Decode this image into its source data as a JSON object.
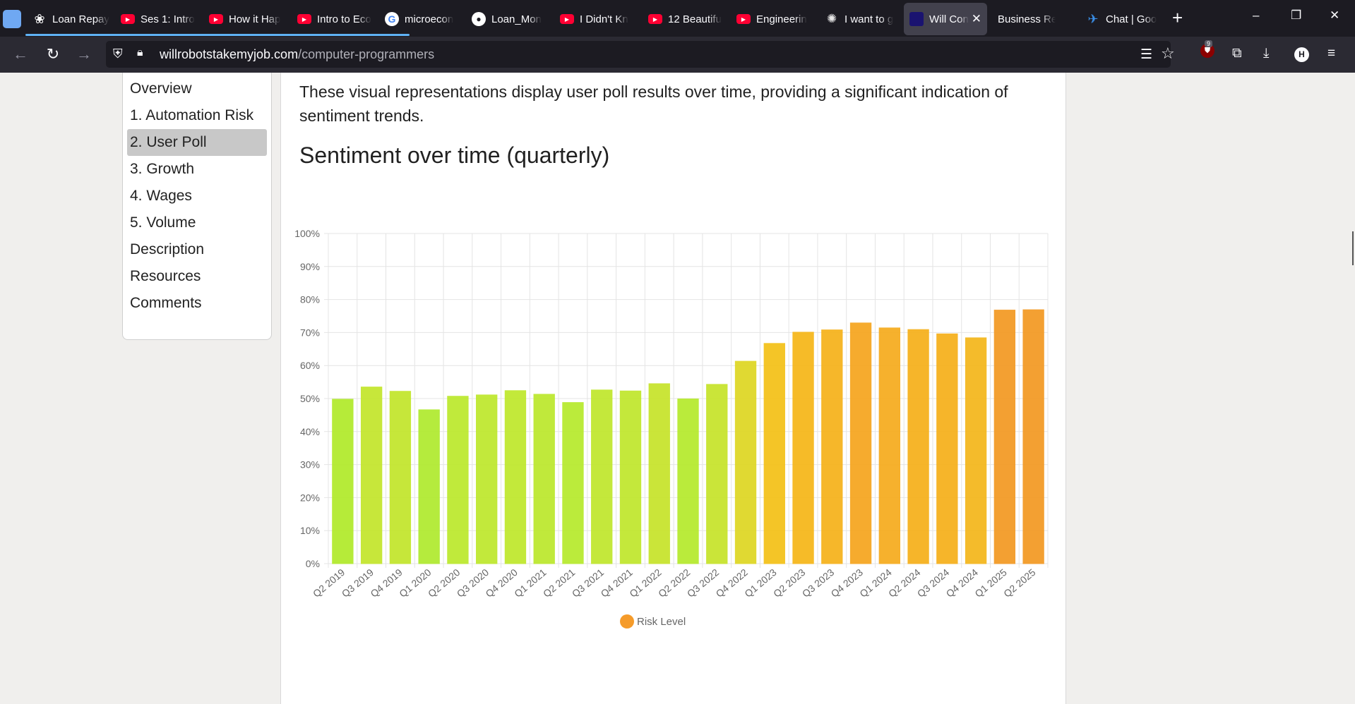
{
  "browser": {
    "tabs": [
      {
        "title": "Loan Repay",
        "icon": "chatgpt-icon"
      },
      {
        "title": "Ses 1: Intro",
        "icon": "youtube-icon"
      },
      {
        "title": "How it Hap",
        "icon": "youtube-icon"
      },
      {
        "title": "Intro to Eco",
        "icon": "youtube-icon"
      },
      {
        "title": "microecon",
        "icon": "google-icon"
      },
      {
        "title": "Loan_Mon",
        "icon": "github-icon"
      },
      {
        "title": "I Didn't Kn",
        "icon": "youtube-icon"
      },
      {
        "title": "12 Beautifu",
        "icon": "youtube-icon"
      },
      {
        "title": "Engineerin",
        "icon": "youtube-icon"
      },
      {
        "title": "I want to g",
        "icon": "claude-icon"
      },
      {
        "title": "Will Con",
        "icon": "site-icon",
        "active": true
      },
      {
        "title": "Business Repor",
        "icon": "none"
      },
      {
        "title": "Chat | Goo",
        "icon": "chatbot-icon"
      }
    ],
    "url_domain": "willrobotstakemyjob.com",
    "url_path": "/computer-programmers",
    "extension_badge_count": "9",
    "profile_initial": "H"
  },
  "toc": {
    "items": [
      "Overview",
      "1. Automation Risk",
      "2. User Poll",
      "3. Growth",
      "4. Wages",
      "5. Volume",
      "Description",
      "Resources",
      "Comments"
    ],
    "active_index": 2
  },
  "content": {
    "intro": "These visual representations display user poll results over time, providing a significant indication of sentiment trends.",
    "heading": "Sentiment over time (quarterly)"
  },
  "chart_data": {
    "type": "bar",
    "categories": [
      "Q2 2019",
      "Q3 2019",
      "Q4 2019",
      "Q1 2020",
      "Q2 2020",
      "Q3 2020",
      "Q4 2020",
      "Q1 2021",
      "Q2 2021",
      "Q3 2021",
      "Q4 2021",
      "Q1 2022",
      "Q2 2022",
      "Q3 2022",
      "Q4 2022",
      "Q1 2023",
      "Q2 2023",
      "Q3 2023",
      "Q4 2023",
      "Q1 2024",
      "Q2 2024",
      "Q3 2024",
      "Q4 2024",
      "Q1 2025",
      "Q2 2025"
    ],
    "series": [
      {
        "name": "Risk Level",
        "values": [
          49.8,
          53.5,
          52.2,
          46.6,
          50.7,
          51.1,
          52.4,
          51.3,
          48.8,
          52.6,
          52.3,
          54.5,
          49.9,
          54.3,
          61.3,
          66.7,
          70.1,
          70.8,
          72.9,
          71.4,
          70.9,
          69.6,
          68.4,
          76.8,
          76.9
        ]
      }
    ],
    "bar_colors": [
      "#b3ea2f",
      "#c5e630",
      "#c3e630",
      "#b2ea33",
      "#bde931",
      "#bfe831",
      "#c0e830",
      "#bde831",
      "#b8ea31",
      "#c1e731",
      "#c1e731",
      "#c8e42f",
      "#b7ea31",
      "#c8e42f",
      "#dfd828",
      "#f4c21c",
      "#f6b81d",
      "#f6b41f",
      "#f6a723",
      "#f6ad22",
      "#f6b21f",
      "#f6b21f",
      "#f4b820",
      "#f39b28",
      "#f39b28"
    ],
    "legend_color": "#f59b2a",
    "ylim": [
      0,
      100
    ],
    "yticks": [
      "0%",
      "10%",
      "20%",
      "30%",
      "40%",
      "50%",
      "60%",
      "70%",
      "80%",
      "90%",
      "100%"
    ],
    "legend_position": "bottom",
    "grid": true
  }
}
